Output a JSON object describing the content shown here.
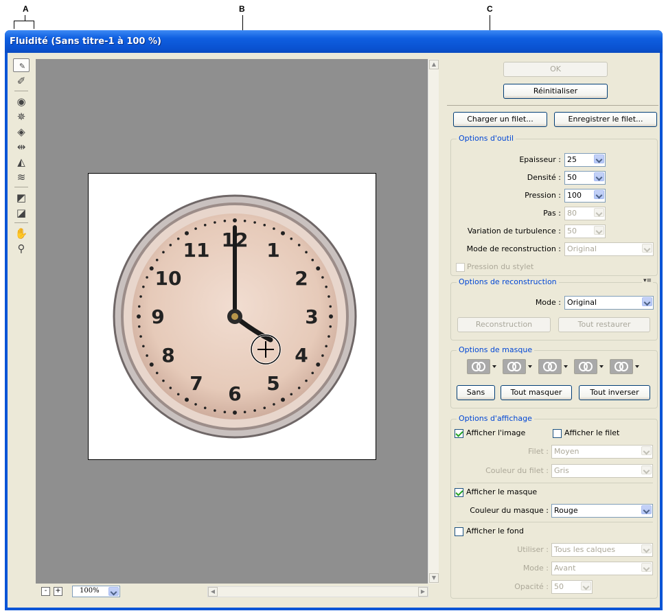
{
  "callouts": {
    "a": "A",
    "b": "B",
    "c": "C"
  },
  "window": {
    "title": "Fluidité (Sans titre-1 à 100 %)"
  },
  "zoom": {
    "minus": "-",
    "plus": "+",
    "value": "100%"
  },
  "clock": {
    "numbers": [
      "12",
      "1",
      "2",
      "3",
      "4",
      "5",
      "6",
      "7",
      "8",
      "9",
      "10",
      "11"
    ]
  },
  "buttons": {
    "ok": "OK",
    "reset": "Réinitialiser",
    "load_mesh": "Charger un filet...",
    "save_mesh": "Enregistrer le filet..."
  },
  "tool_options": {
    "title": "Options d'outil",
    "brush_size": {
      "label": "Epaisseur :",
      "value": "25"
    },
    "density": {
      "label": "Densité :",
      "value": "50"
    },
    "pressure": {
      "label": "Pression :",
      "value": "100"
    },
    "rate": {
      "label": "Pas :",
      "value": "80"
    },
    "turbulence": {
      "label": "Variation de turbulence :",
      "value": "50"
    },
    "recon_mode": {
      "label": "Mode de reconstruction :",
      "value": "Original"
    },
    "stylus": "Pression du stylet"
  },
  "reconstruct_options": {
    "title": "Options de reconstruction",
    "mode_label": "Mode :",
    "mode_value": "Original",
    "reconstruct": "Reconstruction",
    "restore_all": "Tout restaurer"
  },
  "mask_options": {
    "title": "Options de masque",
    "none": "Sans",
    "mask_all": "Tout masquer",
    "invert_all": "Tout inverser"
  },
  "view_options": {
    "title": "Options d'affichage",
    "show_image": "Afficher l'image",
    "show_mesh": "Afficher le filet",
    "mesh_size_label": "Filet :",
    "mesh_size_value": "Moyen",
    "mesh_color_label": "Couleur du filet :",
    "mesh_color_value": "Gris",
    "show_mask": "Afficher le masque",
    "mask_color_label": "Couleur du masque :",
    "mask_color_value": "Rouge",
    "show_backdrop": "Afficher le fond",
    "use_label": "Utiliser :",
    "use_value": "Tous les calques",
    "mode_label": "Mode :",
    "mode_value": "Avant",
    "opacity_label": "Opacité :",
    "opacity_value": "50"
  },
  "colors": {
    "titlebar": "#0a54d6",
    "dialog_bg": "#ece9d8",
    "canvas_bg": "#8f8f8f",
    "group_title": "#0046d5"
  }
}
